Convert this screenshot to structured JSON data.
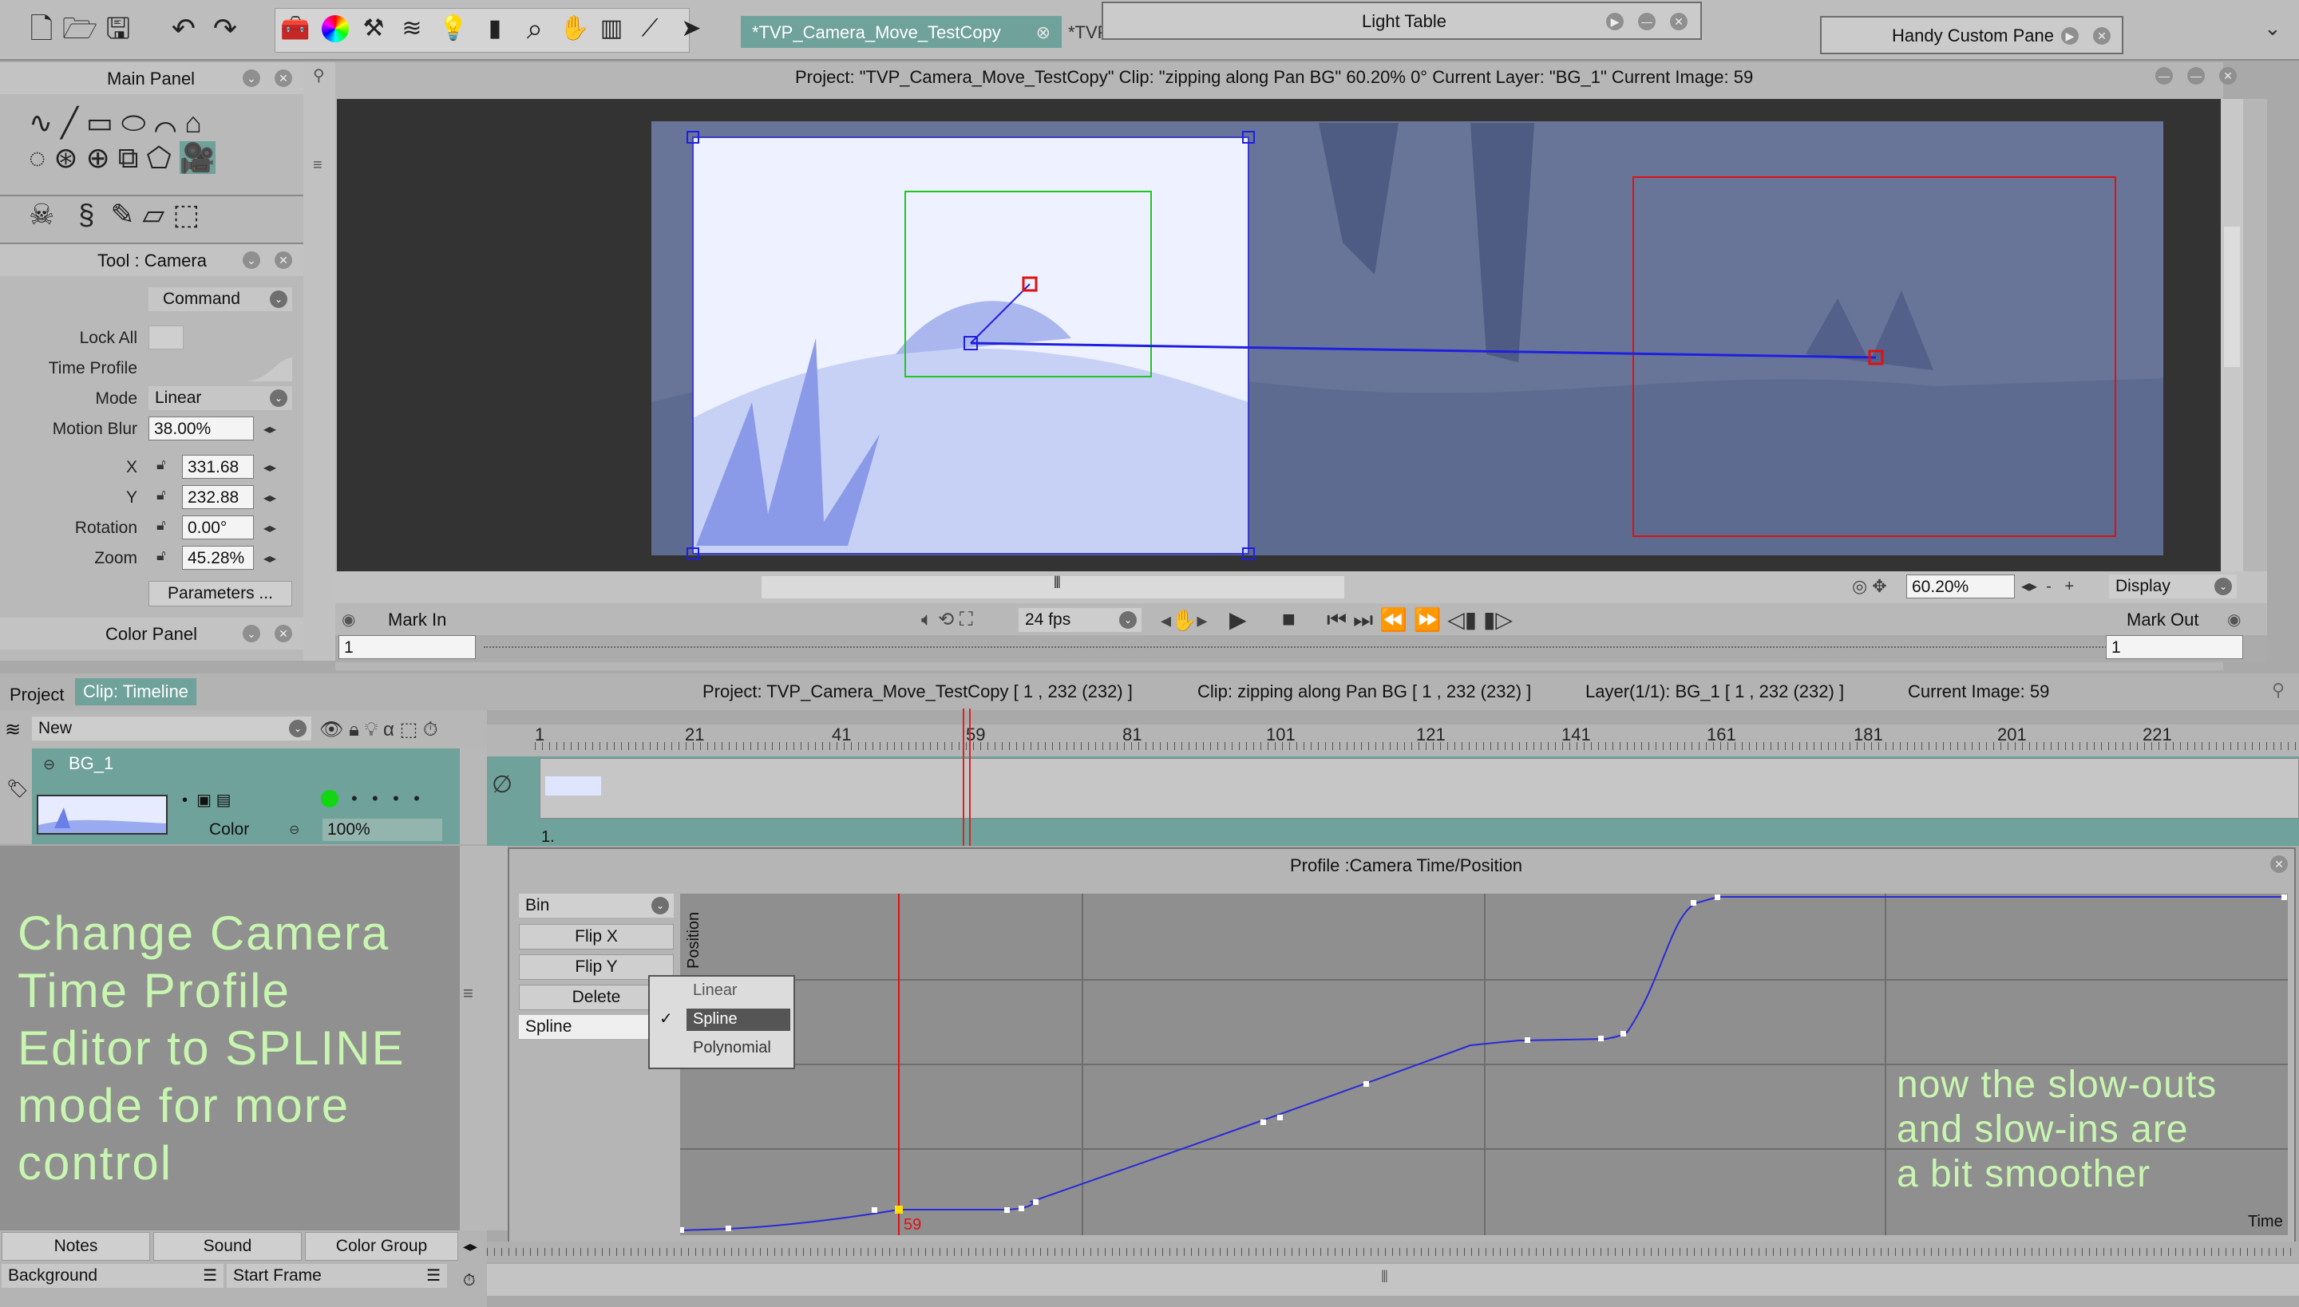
{
  "toolbar": {
    "tabs": [
      "*TVP_Camera_Move_TestCopy",
      "*TVP"
    ],
    "icons": [
      "new-doc-icon",
      "open-icon",
      "save-icon",
      "undo-icon",
      "redo-icon",
      "toolbox-icon",
      "color-wheel-icon",
      "tools-icon",
      "layers-icon",
      "light-icon",
      "ruler-icon",
      "search-icon",
      "hand-icon",
      "library-icon",
      "chart-icon",
      "send-icon"
    ]
  },
  "light_table": {
    "title": "Light Table"
  },
  "handy_pane": {
    "title": "Handy Custom Pane"
  },
  "main_panel": {
    "title": "Main Panel"
  },
  "tool_panel": {
    "title": "Tool : Camera",
    "command": "Command",
    "lock_all": "Lock All",
    "time_profile": "Time Profile",
    "mode_label": "Mode",
    "mode_value": "Linear",
    "motion_blur_label": "Motion Blur",
    "motion_blur_value": "38.00%",
    "x_label": "X",
    "x_value": "331.68",
    "y_label": "Y",
    "y_value": "232.88",
    "rotation_label": "Rotation",
    "rotation_value": "0.00°",
    "zoom_label": "Zoom",
    "zoom_value": "45.28%",
    "parameters": "Parameters ..."
  },
  "color_panel": {
    "title": "Color Panel"
  },
  "viewer": {
    "status": "Project:  \"TVP_Camera_Move_TestCopy\"  Clip: \"zipping along Pan BG\"   60.20%   0°  Current Layer: \"BG_1\"   Current Image: 59",
    "zoom": "60.20%",
    "display": "Display",
    "mark_in": "Mark In",
    "mark_out": "Mark Out",
    "fps": "24 fps",
    "mark_in_value": "1",
    "mark_out_value": "1"
  },
  "timeline": {
    "tab_project": "Project",
    "tab_clip": "Clip: Timeline",
    "project_info": "Project: TVP_Camera_Move_TestCopy [ 1 , 232  (232) ]",
    "clip_info": "Clip: zipping along Pan BG [ 1 , 232  (232) ]",
    "layer_info": "Layer(1/1): BG_1 [ 1 , 232  (232) ]",
    "current_image": "Current Image: 59",
    "new_label": "New",
    "layer_name": "BG_1",
    "color_label": "Color",
    "opacity": "100%",
    "ruler": [
      "1",
      "21",
      "41",
      "59",
      "81",
      "101",
      "121",
      "141",
      "161",
      "181",
      "201",
      "221"
    ],
    "track_start": "1."
  },
  "profile": {
    "title": "Profile :Camera Time/Position",
    "bin": "Bin",
    "flip_x": "Flip X",
    "flip_y": "Flip Y",
    "delete": "Delete",
    "mode": "Spline",
    "menu": [
      "Linear",
      "Spline",
      "Polynomial"
    ],
    "axis_y": "Position",
    "axis_x": "Time",
    "marker": "59",
    "note": [
      "now the slow-outs",
      "and slow-ins are",
      "a bit smoother"
    ]
  },
  "annotation": {
    "lines": [
      "Change Camera",
      "Time Profile",
      "Editor to SPLINE",
      "mode for more",
      "control"
    ]
  },
  "bottom": {
    "notes": "Notes",
    "sound": "Sound",
    "color_group": "Color Group",
    "background": "Background",
    "start_frame": "Start Frame"
  },
  "colors": {
    "accent": "#6fa29a",
    "curve": "#2a2ad8",
    "playhead": "#e01010",
    "annotation": "#c8f5b0"
  }
}
